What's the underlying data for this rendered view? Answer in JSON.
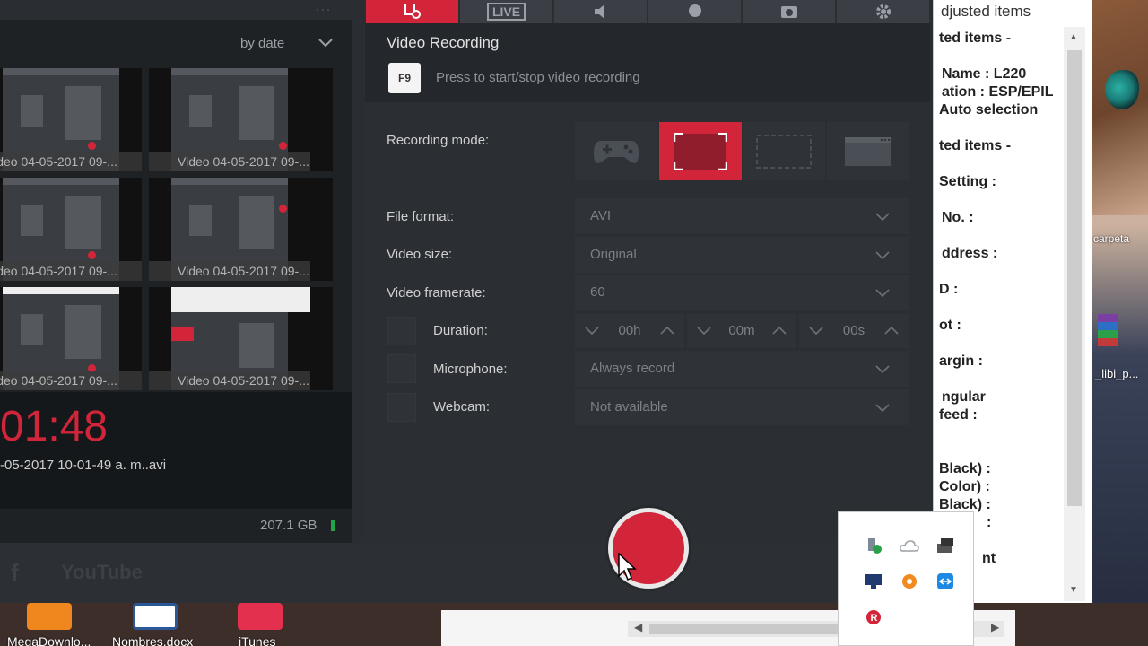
{
  "gallery": {
    "sort_label": "by date",
    "menu_dots": "···",
    "thumbnails": [
      {
        "caption": "Video 04-05-2017 09-..."
      },
      {
        "caption": "Video 04-05-2017 09-..."
      },
      {
        "caption": "Video 04-05-2017 09-..."
      },
      {
        "caption": "Video 04-05-2017 09-..."
      },
      {
        "caption": "Video 04-05-2017 09-..."
      },
      {
        "caption": "Video 04-05-2017 09-..."
      }
    ],
    "selected_time": "01:48",
    "selected_file": "-05-2017 10-01-49 a. m..avi",
    "storage": "207.1 GB"
  },
  "social": {
    "facebook": "f",
    "youtube": "YouTube"
  },
  "tabs": [
    {
      "name": "video-tab",
      "icon": "video-camera-icon",
      "label": ""
    },
    {
      "name": "live-tab",
      "icon": "live-icon",
      "label": "LIVE"
    },
    {
      "name": "audio-tab",
      "icon": "speaker-icon",
      "label": ""
    },
    {
      "name": "webcam-tab",
      "icon": "webcam-icon",
      "label": ""
    },
    {
      "name": "screenshot-tab",
      "icon": "camera-icon",
      "label": ""
    },
    {
      "name": "settings-tab",
      "icon": "gear-icon",
      "label": ""
    }
  ],
  "video": {
    "title": "Video Recording",
    "hotkey": "F9",
    "hint": "Press to start/stop video recording",
    "recording_mode_label": "Recording mode:",
    "recording_modes": [
      "game-mode",
      "fullscreen-mode",
      "region-mode",
      "window-mode"
    ],
    "active_mode": "fullscreen-mode",
    "file_format_label": "File format:",
    "file_format": "AVI",
    "video_size_label": "Video size:",
    "video_size": "Original",
    "framerate_label": "Video framerate:",
    "framerate": "60",
    "duration_label": "Duration:",
    "duration_h": "00h",
    "duration_m": "00m",
    "duration_s": "00s",
    "microphone_label": "Microphone:",
    "microphone": "Always record",
    "webcam_label": "Webcam:",
    "webcam": "Not available"
  },
  "colors": {
    "accent": "#d2253a",
    "panel": "#2b2f34",
    "field": "#2f3338"
  },
  "notepad": {
    "title": "djusted items",
    "lines": [
      "ted items -",
      "Name : L220",
      "ation : ESP/EPIL",
      "Auto selection",
      "ted items -",
      "Setting :",
      "No. :",
      "ddress :",
      "D :",
      "ot :",
      "argin :",
      "ngular",
      "feed :",
      "Black) :",
      "Color) :",
      "Black) :",
      ":",
      "nt"
    ]
  },
  "desktop": {
    "label_1": "carpeta",
    "label_2": "_libi_p...",
    "icons": [
      {
        "label": "MegaDownlo..."
      },
      {
        "label": "Nombres.docx"
      },
      {
        "label": "iTunes"
      }
    ]
  },
  "tray": {
    "icons": [
      "usb-icon",
      "onedrive-icon",
      "network-icon",
      "display-icon",
      "avast-icon",
      "teamviewer-icon",
      "bandicam-icon"
    ]
  }
}
